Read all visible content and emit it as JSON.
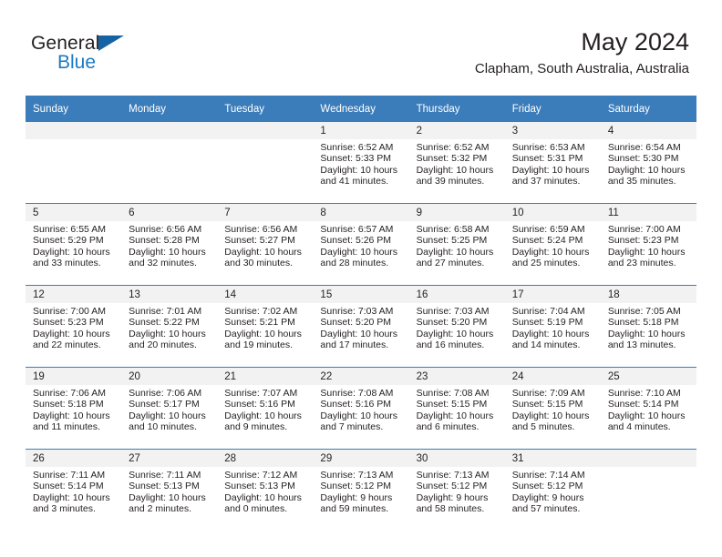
{
  "brand": {
    "line1": "General",
    "line2": "Blue",
    "accent_color": "#1b7ac4",
    "triangle_color": "#1464a5"
  },
  "header": {
    "title": "May 2024",
    "subtitle": "Clapham, South Australia, Australia",
    "header_bg": "#3b7cba",
    "daynum_bg": "#f2f2f2"
  },
  "weekdays": [
    "Sunday",
    "Monday",
    "Tuesday",
    "Wednesday",
    "Thursday",
    "Friday",
    "Saturday"
  ],
  "labels": {
    "sunrise": "Sunrise:",
    "sunset": "Sunset:",
    "daylight": "Daylight:"
  },
  "weeks": [
    [
      {
        "day": "",
        "empty": true
      },
      {
        "day": "",
        "empty": true
      },
      {
        "day": "",
        "empty": true
      },
      {
        "day": "1",
        "sunrise": "Sunrise: 6:52 AM",
        "sunset": "Sunset: 5:33 PM",
        "daylight": "Daylight: 10 hours and 41 minutes."
      },
      {
        "day": "2",
        "sunrise": "Sunrise: 6:52 AM",
        "sunset": "Sunset: 5:32 PM",
        "daylight": "Daylight: 10 hours and 39 minutes."
      },
      {
        "day": "3",
        "sunrise": "Sunrise: 6:53 AM",
        "sunset": "Sunset: 5:31 PM",
        "daylight": "Daylight: 10 hours and 37 minutes."
      },
      {
        "day": "4",
        "sunrise": "Sunrise: 6:54 AM",
        "sunset": "Sunset: 5:30 PM",
        "daylight": "Daylight: 10 hours and 35 minutes."
      }
    ],
    [
      {
        "day": "5",
        "sunrise": "Sunrise: 6:55 AM",
        "sunset": "Sunset: 5:29 PM",
        "daylight": "Daylight: 10 hours and 33 minutes."
      },
      {
        "day": "6",
        "sunrise": "Sunrise: 6:56 AM",
        "sunset": "Sunset: 5:28 PM",
        "daylight": "Daylight: 10 hours and 32 minutes."
      },
      {
        "day": "7",
        "sunrise": "Sunrise: 6:56 AM",
        "sunset": "Sunset: 5:27 PM",
        "daylight": "Daylight: 10 hours and 30 minutes."
      },
      {
        "day": "8",
        "sunrise": "Sunrise: 6:57 AM",
        "sunset": "Sunset: 5:26 PM",
        "daylight": "Daylight: 10 hours and 28 minutes."
      },
      {
        "day": "9",
        "sunrise": "Sunrise: 6:58 AM",
        "sunset": "Sunset: 5:25 PM",
        "daylight": "Daylight: 10 hours and 27 minutes."
      },
      {
        "day": "10",
        "sunrise": "Sunrise: 6:59 AM",
        "sunset": "Sunset: 5:24 PM",
        "daylight": "Daylight: 10 hours and 25 minutes."
      },
      {
        "day": "11",
        "sunrise": "Sunrise: 7:00 AM",
        "sunset": "Sunset: 5:23 PM",
        "daylight": "Daylight: 10 hours and 23 minutes."
      }
    ],
    [
      {
        "day": "12",
        "sunrise": "Sunrise: 7:00 AM",
        "sunset": "Sunset: 5:23 PM",
        "daylight": "Daylight: 10 hours and 22 minutes."
      },
      {
        "day": "13",
        "sunrise": "Sunrise: 7:01 AM",
        "sunset": "Sunset: 5:22 PM",
        "daylight": "Daylight: 10 hours and 20 minutes."
      },
      {
        "day": "14",
        "sunrise": "Sunrise: 7:02 AM",
        "sunset": "Sunset: 5:21 PM",
        "daylight": "Daylight: 10 hours and 19 minutes."
      },
      {
        "day": "15",
        "sunrise": "Sunrise: 7:03 AM",
        "sunset": "Sunset: 5:20 PM",
        "daylight": "Daylight: 10 hours and 17 minutes."
      },
      {
        "day": "16",
        "sunrise": "Sunrise: 7:03 AM",
        "sunset": "Sunset: 5:20 PM",
        "daylight": "Daylight: 10 hours and 16 minutes."
      },
      {
        "day": "17",
        "sunrise": "Sunrise: 7:04 AM",
        "sunset": "Sunset: 5:19 PM",
        "daylight": "Daylight: 10 hours and 14 minutes."
      },
      {
        "day": "18",
        "sunrise": "Sunrise: 7:05 AM",
        "sunset": "Sunset: 5:18 PM",
        "daylight": "Daylight: 10 hours and 13 minutes."
      }
    ],
    [
      {
        "day": "19",
        "sunrise": "Sunrise: 7:06 AM",
        "sunset": "Sunset: 5:18 PM",
        "daylight": "Daylight: 10 hours and 11 minutes."
      },
      {
        "day": "20",
        "sunrise": "Sunrise: 7:06 AM",
        "sunset": "Sunset: 5:17 PM",
        "daylight": "Daylight: 10 hours and 10 minutes."
      },
      {
        "day": "21",
        "sunrise": "Sunrise: 7:07 AM",
        "sunset": "Sunset: 5:16 PM",
        "daylight": "Daylight: 10 hours and 9 minutes."
      },
      {
        "day": "22",
        "sunrise": "Sunrise: 7:08 AM",
        "sunset": "Sunset: 5:16 PM",
        "daylight": "Daylight: 10 hours and 7 minutes."
      },
      {
        "day": "23",
        "sunrise": "Sunrise: 7:08 AM",
        "sunset": "Sunset: 5:15 PM",
        "daylight": "Daylight: 10 hours and 6 minutes."
      },
      {
        "day": "24",
        "sunrise": "Sunrise: 7:09 AM",
        "sunset": "Sunset: 5:15 PM",
        "daylight": "Daylight: 10 hours and 5 minutes."
      },
      {
        "day": "25",
        "sunrise": "Sunrise: 7:10 AM",
        "sunset": "Sunset: 5:14 PM",
        "daylight": "Daylight: 10 hours and 4 minutes."
      }
    ],
    [
      {
        "day": "26",
        "sunrise": "Sunrise: 7:11 AM",
        "sunset": "Sunset: 5:14 PM",
        "daylight": "Daylight: 10 hours and 3 minutes."
      },
      {
        "day": "27",
        "sunrise": "Sunrise: 7:11 AM",
        "sunset": "Sunset: 5:13 PM",
        "daylight": "Daylight: 10 hours and 2 minutes."
      },
      {
        "day": "28",
        "sunrise": "Sunrise: 7:12 AM",
        "sunset": "Sunset: 5:13 PM",
        "daylight": "Daylight: 10 hours and 0 minutes."
      },
      {
        "day": "29",
        "sunrise": "Sunrise: 7:13 AM",
        "sunset": "Sunset: 5:12 PM",
        "daylight": "Daylight: 9 hours and 59 minutes."
      },
      {
        "day": "30",
        "sunrise": "Sunrise: 7:13 AM",
        "sunset": "Sunset: 5:12 PM",
        "daylight": "Daylight: 9 hours and 58 minutes."
      },
      {
        "day": "31",
        "sunrise": "Sunrise: 7:14 AM",
        "sunset": "Sunset: 5:12 PM",
        "daylight": "Daylight: 9 hours and 57 minutes."
      },
      {
        "day": "",
        "empty": true
      }
    ]
  ]
}
